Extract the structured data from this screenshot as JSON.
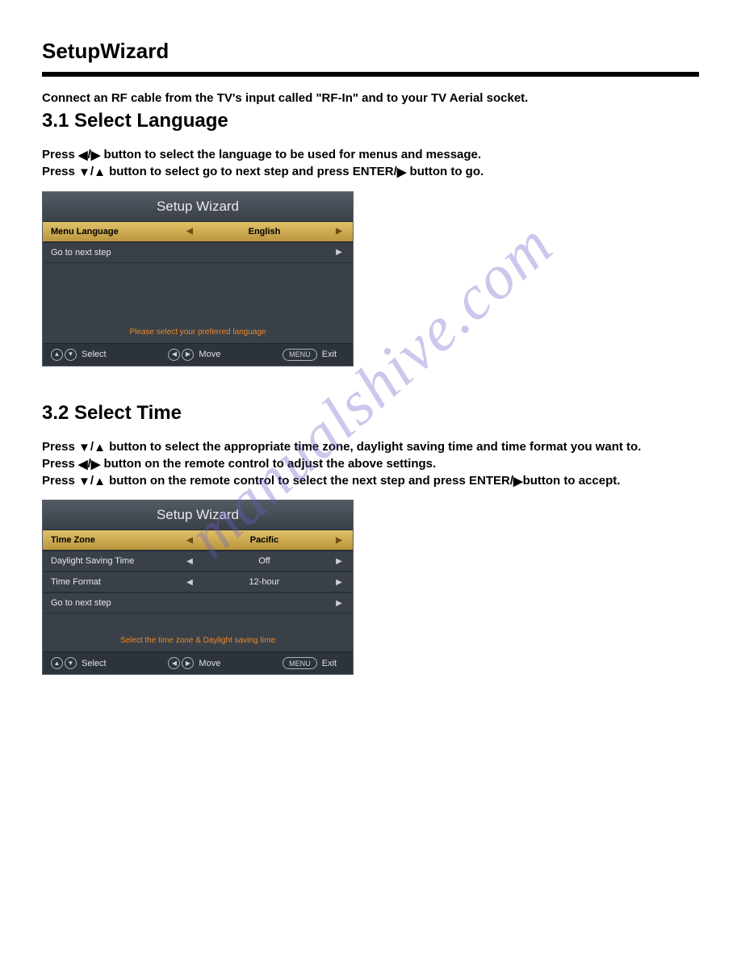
{
  "page_title": "SetupWizard",
  "intro": "Connect an RF cable from the TV's input called \"RF-In\" and to your TV Aerial socket.",
  "watermark": "manualshive.com",
  "symbols": {
    "left": "◀",
    "right": "▶",
    "up": "▲",
    "down": "▼"
  },
  "section1": {
    "heading": "3.1 Select Language",
    "instr1_pre": "Press ",
    "instr1_post": " button to select the language to be used for menus and message.",
    "instr2_pre": "Press ",
    "instr2_mid": " button to select go to next step and press ENTER/",
    "instr2_post": " button to go.",
    "wizard": {
      "title": "Setup Wizard",
      "rows": [
        {
          "label": "Menu Language",
          "value": "English",
          "highlight": true,
          "left": true,
          "right": true
        },
        {
          "label": "Go to next step",
          "value": "",
          "highlight": false,
          "left": false,
          "right": true
        }
      ],
      "hint": "Please select your preferred language",
      "footer": {
        "select": "Select",
        "move": "Move",
        "menu": "MENU",
        "exit": "Exit"
      }
    }
  },
  "section2": {
    "heading": "3.2 Select Time",
    "instr1_pre": "Press ",
    "instr1_post": " button to select the appropriate time zone, daylight saving time and time format you want to.",
    "instr2_pre": "Press ",
    "instr2_post": " button on the remote control to adjust the above settings.",
    "instr3_pre": "Press ",
    "instr3_mid": " button on the remote control to select the next step and press ENTER/",
    "instr3_post": "button to accept.",
    "wizard": {
      "title": "Setup Wizard",
      "rows": [
        {
          "label": "Time Zone",
          "value": "Pacific",
          "highlight": true,
          "left": true,
          "right": true
        },
        {
          "label": "Daylight Saving Time",
          "value": "Off",
          "highlight": false,
          "left": true,
          "right": true
        },
        {
          "label": "Time Format",
          "value": "12-hour",
          "highlight": false,
          "left": true,
          "right": true
        },
        {
          "label": "Go to next step",
          "value": "",
          "highlight": false,
          "left": false,
          "right": true
        }
      ],
      "hint": "Select the time zone & Daylight saving time",
      "footer": {
        "select": "Select",
        "move": "Move",
        "menu": "MENU",
        "exit": "Exit"
      }
    }
  }
}
